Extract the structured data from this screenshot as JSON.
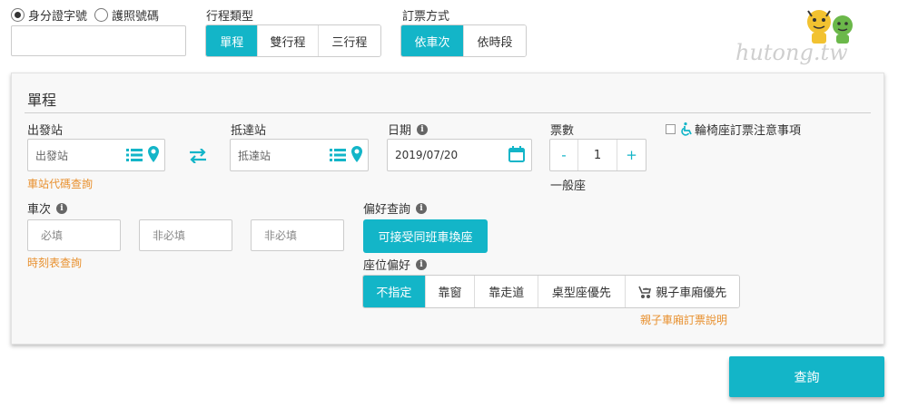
{
  "id_type": {
    "options": [
      {
        "label": "身分證字號",
        "checked": true
      },
      {
        "label": "護照號碼",
        "checked": false
      }
    ],
    "input_value": ""
  },
  "trip_type": {
    "label": "行程類型",
    "options": [
      "單程",
      "雙行程",
      "三行程"
    ],
    "active_index": 0
  },
  "booking_method": {
    "label": "訂票方式",
    "options": [
      "依車次",
      "依時段"
    ],
    "active_index": 0
  },
  "logo": {
    "text": "hutong.tw"
  },
  "form": {
    "title": "單程",
    "departure": {
      "label": "出發站",
      "placeholder": "出發站",
      "link": "車站代碼查詢"
    },
    "arrival": {
      "label": "抵達站",
      "placeholder": "抵達站"
    },
    "date": {
      "label": "日期",
      "value": "2019/07/20"
    },
    "tickets": {
      "label": "票數",
      "minus": "-",
      "count": "1",
      "plus": "+",
      "type": "一般座"
    },
    "wheelchair": {
      "label": "輪椅座訂票注意事項",
      "checked": false
    },
    "train_no": {
      "label": "車次",
      "inputs": [
        "必填",
        "非必填",
        "非必填"
      ],
      "link": "時刻表查詢"
    },
    "preference": {
      "label": "偏好查詢",
      "button": "可接受同班車換座"
    },
    "seat_pref": {
      "label": "座位偏好",
      "options": [
        "不指定",
        "靠窗",
        "靠走道",
        "桌型座優先",
        "親子車廂優先"
      ],
      "active_index": 0,
      "link": "親子車廂訂票說明"
    }
  },
  "submit": {
    "label": "查詢"
  },
  "colors": {
    "accent": "#13b5c8",
    "link": "#e8902e"
  }
}
